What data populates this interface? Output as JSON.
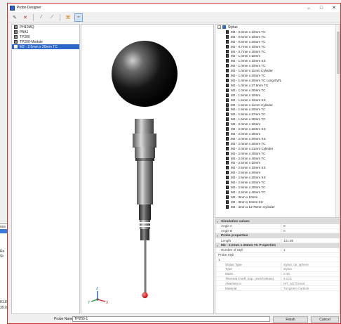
{
  "window": {
    "title": "Probe Designer",
    "controls": [
      "–",
      "□",
      "✕"
    ]
  },
  "background": {
    "labels": [
      "nce",
      "Re",
      "St",
      "81.83",
      "39.0"
    ]
  },
  "toolbar": {
    "tools": [
      {
        "name": "pencil-icon",
        "glyph": "✎"
      },
      {
        "name": "delete-icon",
        "glyph": "✕"
      },
      {
        "name": "pencil-icon-2",
        "glyph": "⁄"
      },
      {
        "name": "pen-icon",
        "glyph": "⟋"
      },
      {
        "name": "fit-view-icon",
        "glyph": "⌘"
      },
      {
        "name": "probe-view-icon",
        "glyph": "⌖"
      }
    ]
  },
  "left_tree": {
    "items": [
      "PH10MQ",
      "PAA1",
      "TP200",
      "TP200-Module",
      "M2 - 2.0mm x 20mm TC"
    ],
    "selected_index": 4
  },
  "right_tree": {
    "root_label": "Stylus",
    "items": [
      "M2 - 0.3mm x 10mm TC",
      "M2 - 0.5mm x 10mm TC",
      "M2 - 0.5mm x 20mm TC",
      "M2 - 0.7mm x 10mm TC",
      "M2 - 0.7mm x 20mm TC",
      "M2 - 1.0mm x 10mm",
      "M2 - 1.0mm x 10mm SS",
      "M2 - 1.0mm x 10mm TC",
      "M2 - 1.0mm x 11mm Cylinder",
      "M2 - 1.0mm x 20mm TC",
      "M2 - 1.0mm x 20mm TC Long EWL",
      "M2 - 1.0mm x 27.5mm TC",
      "M2 - 1.0mm x 30mm TC",
      "M2 - 1.5mm x 10mm",
      "M2 - 1.5mm x 10mm SS",
      "M2 - 1.5mm x 11mm Cylinder",
      "M2 - 1.5mm x 20mm TC",
      "M2 - 1.5mm x 27mm TC",
      "M2 - 1.5mm x 30mm TC",
      "M2 - 2.0mm x 10mm",
      "M2 - 2.0mm x 10mm SS",
      "M2 - 2.0mm x 20mm",
      "M2 - 2.0mm x 20mm SS",
      "M2 - 2.0mm x 20mm TC",
      "M2 - 2.0mm x 21mm Cylinder",
      "M2 - 2.0mm x 30mm TC",
      "M2 - 2.0mm x 40mm TC",
      "M2 - 2.5mm x 10mm",
      "M2 - 2.5mm x 10mm SS",
      "M2 - 2.5mm x 20mm",
      "M2 - 2.5mm x 20mm SS",
      "M2 - 2.5mm x 20mm TC",
      "M2 - 2.5mm x 30mm TC",
      "M2 - 2.5mm x 40mm TC",
      "M2 - 3mm x 10mm",
      "M2 - 3mm x 10mm SS",
      "M2 - 3mm x 12.75mm Cylinder"
    ]
  },
  "properties": {
    "rows": [
      {
        "type": "cat",
        "label": "Simulation values"
      },
      {
        "type": "row",
        "k": "Angle A",
        "v": "0"
      },
      {
        "type": "row",
        "k": "Angle B",
        "v": "0"
      },
      {
        "type": "cat",
        "label": "Probe properties"
      },
      {
        "type": "row",
        "k": "Length",
        "v": "131.85"
      },
      {
        "type": "cat",
        "label": "M2 - 2.0mm x 20mm TC Properties"
      },
      {
        "type": "row",
        "k": "Number of Styli",
        "v": "1"
      },
      {
        "type": "sub",
        "k": "Probe Styli",
        "v": ""
      },
      {
        "type": "sub",
        "k": "1",
        "v": ""
      },
      {
        "type": "indent",
        "k": "Stylus Type",
        "v": "stylus_tip_sphere"
      },
      {
        "type": "indent",
        "k": "Type",
        "v": "stylus"
      },
      {
        "type": "indent",
        "k": "Mass",
        "v": "0.45"
      },
      {
        "type": "indent",
        "k": "Thermal Coeff. Exp. (mm/Celsius)",
        "v": "6.075"
      },
      {
        "type": "indent",
        "k": "Attaches to",
        "v": "MT_M2Thread"
      },
      {
        "type": "indent",
        "k": "Material",
        "v": "Tungsten Carbide"
      }
    ]
  },
  "viewport": {
    "axis_labels": {
      "x": "X",
      "y": "Y",
      "z": "Z"
    },
    "colors": {
      "x": "#d62020",
      "y": "#1d9e3c",
      "z": "#2255d0",
      "tip": "#e01515"
    }
  },
  "bottom": {
    "probe_name_label": "Probe Name:",
    "probe_name_value": "TP200-1",
    "finish_label": "Finish",
    "cancel_label": "Cancel"
  }
}
